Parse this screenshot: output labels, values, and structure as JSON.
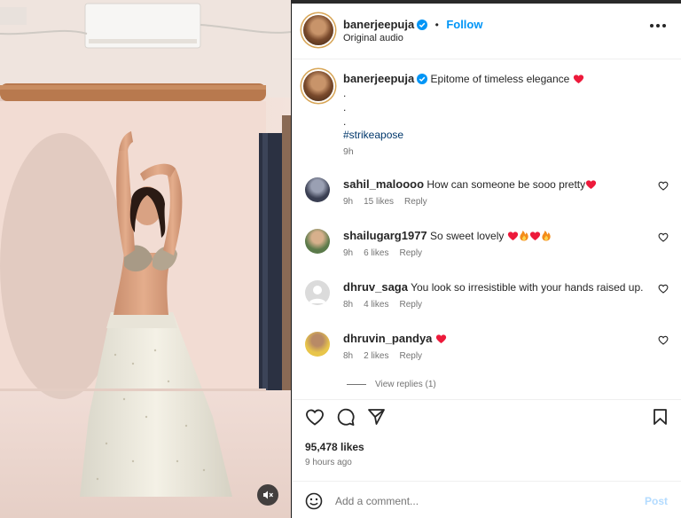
{
  "post": {
    "author": "banerjeepuja",
    "follow_label": "Follow",
    "audio": "Original audio",
    "caption_text": "Epitome of timeless elegance",
    "caption_dots": [
      ".",
      ".",
      "."
    ],
    "hashtag": "#strikeapose",
    "caption_time": "9h",
    "likes": "95,478 likes",
    "posted": "9 hours ago",
    "comment_placeholder": "Add a comment...",
    "post_label": "Post"
  },
  "comments": [
    {
      "user": "sahil_maloooo",
      "text": "How can someone be sooo pretty",
      "emoji": [
        "heart"
      ],
      "time": "9h",
      "likes": "15 likes",
      "reply": "Reply",
      "avatar_color": "#3a3f52"
    },
    {
      "user": "shailugarg1977",
      "text": "So sweet lovely",
      "emoji": [
        "heart",
        "fire",
        "heart",
        "fire"
      ],
      "time": "9h",
      "likes": "6 likes",
      "reply": "Reply",
      "avatar_color": "#5b7a4a"
    },
    {
      "user": "dhruv_saga",
      "text": "You look so irresistible with your hands raised up.",
      "emoji": [],
      "time": "8h",
      "likes": "4 likes",
      "reply": "Reply",
      "avatar_color": "#dbdbdb"
    },
    {
      "user": "dhruvin_pandya",
      "text": "",
      "emoji": [
        "heart"
      ],
      "time": "8h",
      "likes": "2 likes",
      "reply": "Reply",
      "avatar_color": "#e8c54a"
    }
  ],
  "view_replies": "View replies (1)",
  "colors": {
    "link_blue": "#0095f6",
    "hashtag": "#00376b",
    "secondary": "#737373",
    "heart_red": "#ed1a3b",
    "post_disabled": "#b3dbff"
  }
}
